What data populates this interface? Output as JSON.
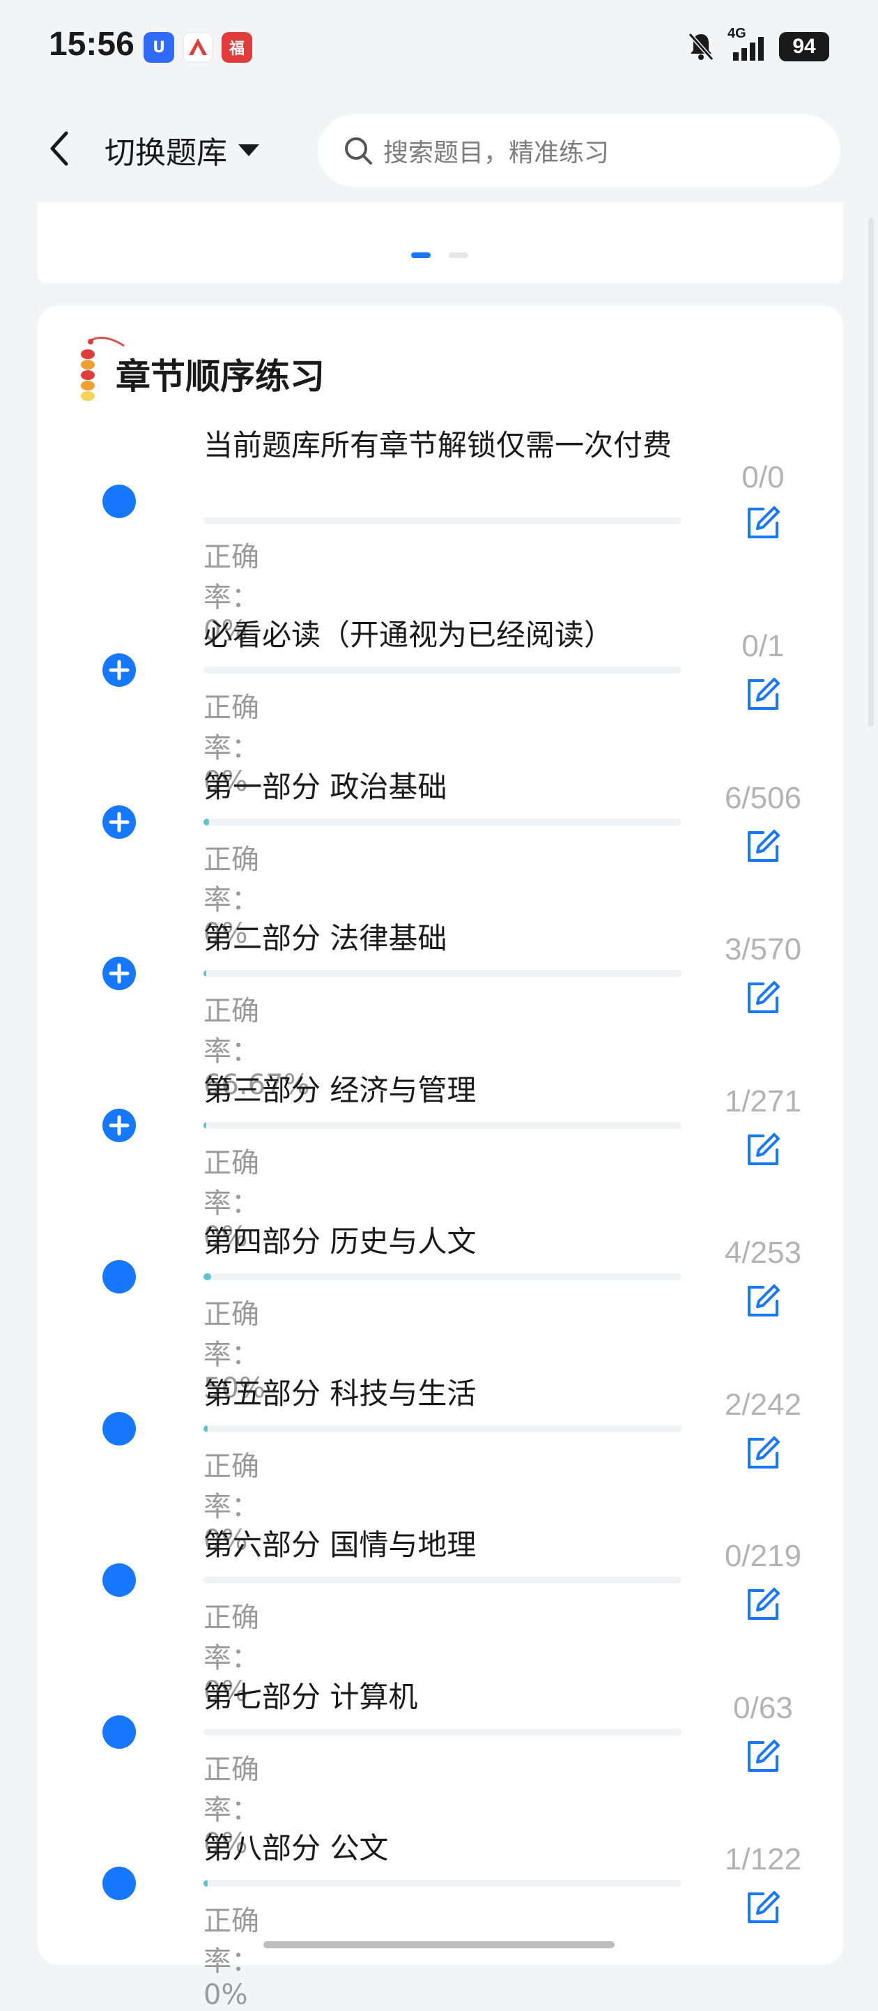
{
  "status_bar": {
    "time": "15:56",
    "network": "4G",
    "battery": "94",
    "app_icons": [
      {
        "name": "app-icon-blue",
        "color": "#2f6bff"
      },
      {
        "name": "app-icon-red-white",
        "color": "#ffffff"
      },
      {
        "name": "app-icon-red",
        "color": "#e23b3b"
      }
    ]
  },
  "header": {
    "switch_bank_label": "切换题库",
    "search_placeholder": "搜索题目，精准练习"
  },
  "section": {
    "title": "章节顺序练习"
  },
  "colors": {
    "accent": "#1677ff",
    "progress": "#5ec4d4"
  },
  "chapters": [
    {
      "title": "当前题库所有章节解锁仅需一次付费",
      "count": "0/0",
      "accuracy": "正确率：0%",
      "progress": 0,
      "icon": "filled"
    },
    {
      "title": "必看必读（开通视为已经阅读）",
      "count": "0/1",
      "accuracy": "正确率：0%",
      "progress": 0,
      "icon": "plus"
    },
    {
      "title": "第一部分 政治基础",
      "count": "6/506",
      "accuracy": "正确率：0%",
      "progress": 0.0119,
      "icon": "plus"
    },
    {
      "title": "第二部分 法律基础",
      "count": "3/570",
      "accuracy": "正确率：66.67%",
      "progress": 0.0053,
      "icon": "plus"
    },
    {
      "title": "第三部分 经济与管理",
      "count": "1/271",
      "accuracy": "正确率：0%",
      "progress": 0.0037,
      "icon": "plus"
    },
    {
      "title": "第四部分 历史与人文",
      "count": "4/253",
      "accuracy": "正确率：50%",
      "progress": 0.0158,
      "icon": "filled"
    },
    {
      "title": "第五部分 科技与生活",
      "count": "2/242",
      "accuracy": "正确率：0%",
      "progress": 0.0083,
      "icon": "filled"
    },
    {
      "title": "第六部分 国情与地理",
      "count": "0/219",
      "accuracy": "正确率：0%",
      "progress": 0,
      "icon": "filled"
    },
    {
      "title": "第七部分 计算机",
      "count": "0/63",
      "accuracy": "正确率：0%",
      "progress": 0,
      "icon": "filled"
    },
    {
      "title": "第八部分 公文",
      "count": "1/122",
      "accuracy": "正确率：0%",
      "progress": 0.0082,
      "icon": "filled"
    }
  ]
}
